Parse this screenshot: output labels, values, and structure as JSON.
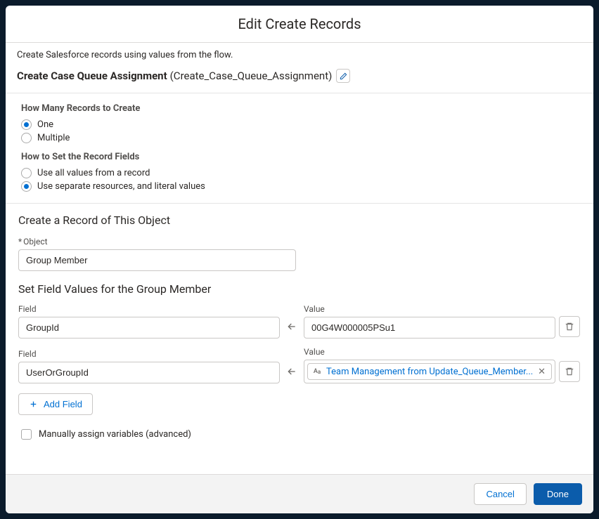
{
  "modal": {
    "title": "Edit Create Records",
    "description": "Create Salesforce records using values from the flow.",
    "record_label": "Create Case Queue Assignment",
    "record_api": "(Create_Case_Queue_Assignment)"
  },
  "howMany": {
    "label": "How Many Records to Create",
    "one": "One",
    "multiple": "Multiple"
  },
  "howSet": {
    "label": "How to Set the Record Fields",
    "all": "Use all values from a record",
    "sep": "Use separate resources, and literal values"
  },
  "object": {
    "heading": "Create a Record of This Object",
    "label": "Object",
    "value": "Group Member"
  },
  "fieldValues": {
    "heading": "Set Field Values for the Group Member",
    "fieldLabel": "Field",
    "valueLabel": "Value",
    "rows": [
      {
        "field": "GroupId",
        "value": "00G4W000005PSu1"
      },
      {
        "field": "UserOrGroupId",
        "pill": "Team Management from Update_Queue_Member..."
      }
    ],
    "addField": "Add Field"
  },
  "advanced": {
    "label": "Manually assign variables (advanced)"
  },
  "footer": {
    "cancel": "Cancel",
    "done": "Done"
  }
}
